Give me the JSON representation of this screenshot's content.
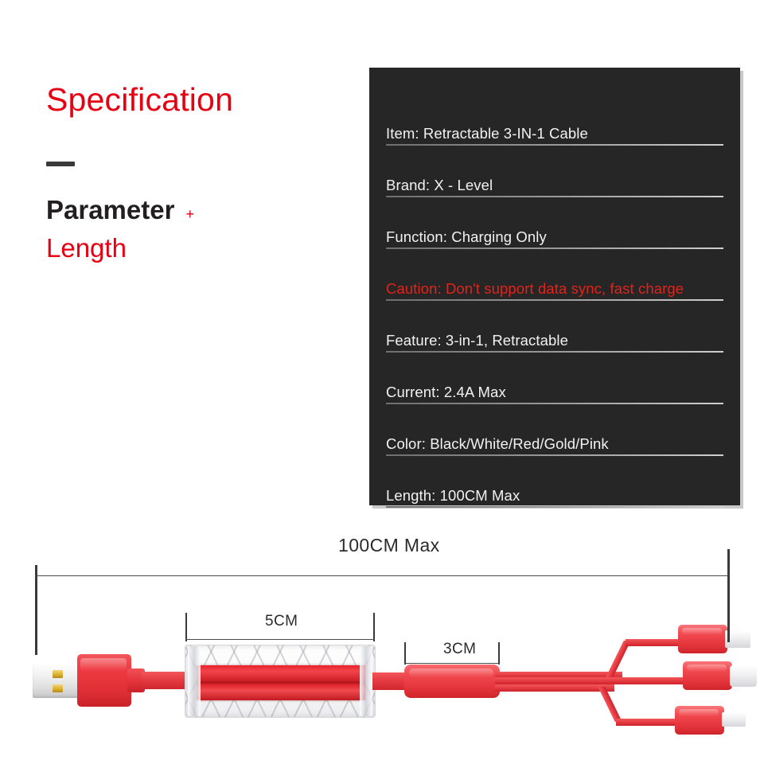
{
  "heading": {
    "title": "Specification",
    "divider": "dash-mark",
    "parameter_label": "Parameter",
    "parameter_plus": "+",
    "length_label": "Length"
  },
  "spec_panel": {
    "background_color": "#262626",
    "rows": [
      {
        "text": "Item: Retractable 3-IN-1 Cable",
        "highlight": false
      },
      {
        "text": "Brand: X - Level",
        "highlight": false
      },
      {
        "text": "Function: Charging Only",
        "highlight": false
      },
      {
        "text": "Caution: Don't support data sync, fast charge",
        "highlight": true
      },
      {
        "text": "Feature: 3-in-1, Retractable",
        "highlight": false
      },
      {
        "text": "Current: 2.4A Max",
        "highlight": false
      },
      {
        "text": "Color: Black/White/Red/Gold/Pink",
        "highlight": false
      },
      {
        "text": "Length: 100CM Max",
        "highlight": false
      }
    ]
  },
  "diagram": {
    "overall_length_label": "100CM Max",
    "spool_length_label": "5CM",
    "splitter_length_label": "3CM",
    "product": {
      "usb_connector": "usb-a-plug",
      "spool": "retractable-crystal-spool",
      "splitter": "three-way-splitter",
      "connectors": [
        "micro-usb-connector",
        "usb-c-connector",
        "lightning-connector"
      ]
    }
  },
  "colors": {
    "accent_red": "#e60012",
    "caution_red": "#e2231a",
    "panel_bg": "#262626",
    "text_dark": "#231f20",
    "cable_red": "#e53b42"
  }
}
